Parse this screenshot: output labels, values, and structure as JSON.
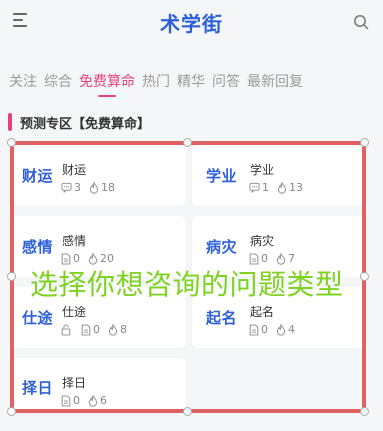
{
  "header": {
    "title": "术学街",
    "menu_icon": "hamburger-menu-icon",
    "search_icon": "search-icon"
  },
  "tabs": [
    {
      "label": "关注",
      "active": false
    },
    {
      "label": "综合",
      "active": false
    },
    {
      "label": "免费算命",
      "active": true
    },
    {
      "label": "热门",
      "active": false
    },
    {
      "label": "精华",
      "active": false
    },
    {
      "label": "问答",
      "active": false
    },
    {
      "label": "最新回复",
      "active": false
    }
  ],
  "section": {
    "title": "预测专区【免费算命】"
  },
  "cards": [
    {
      "big": "财运",
      "name": "财运",
      "icon": "comment-icon",
      "count": "3",
      "hot": "18"
    },
    {
      "big": "学业",
      "name": "学业",
      "icon": "comment-icon",
      "count": "1",
      "hot": "13"
    },
    {
      "big": "感情",
      "name": "感情",
      "icon": "document-icon",
      "count": "0",
      "hot": "20"
    },
    {
      "big": "病灾",
      "name": "病灾",
      "icon": "document-icon",
      "count": "0",
      "hot": "7"
    },
    {
      "big": "仕途",
      "name": "仕途",
      "icon": "document-icon",
      "lock": true,
      "count": "0",
      "hot": "8"
    },
    {
      "big": "起名",
      "name": "起名",
      "icon": "document-icon",
      "count": "0",
      "hot": "4"
    },
    {
      "big": "择日",
      "name": "择日",
      "icon": "document-icon",
      "count": "0",
      "hot": "6"
    }
  ],
  "overlay": {
    "text": "选择你想咨询的问题类型"
  },
  "colors": {
    "accent_pink": "#e6427d",
    "title_blue": "#2d5fd8",
    "selection_red": "#dc4646",
    "overlay_green": "#7ed321"
  }
}
